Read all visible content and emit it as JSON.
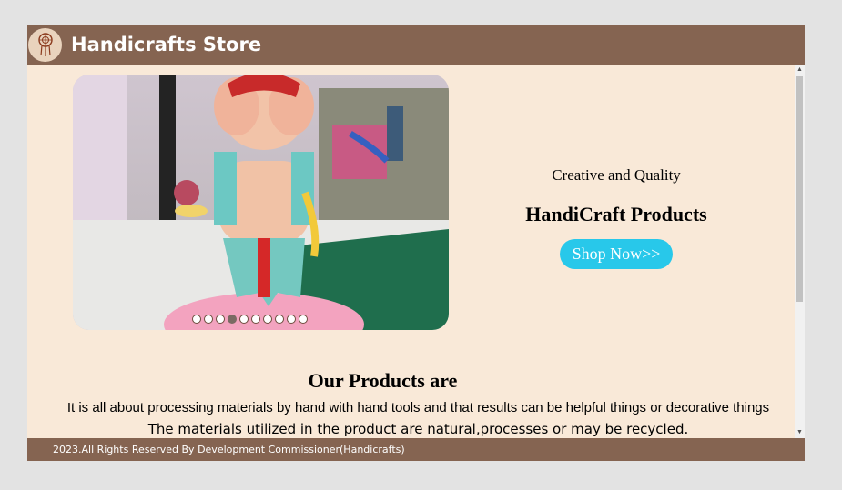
{
  "header": {
    "store_name": "Handicrafts Store",
    "logo_icon": "dreamcatcher-icon"
  },
  "carousel": {
    "slide_count": 10,
    "active_index": 3
  },
  "promo": {
    "tagline": "Creative and Quality",
    "title": "HandiCraft Products",
    "button_label": "Shop Now>>"
  },
  "products": {
    "title": "Our Products are",
    "line1": "It is all about processing materials by hand with hand tools and that results can be helpful things or decorative things",
    "line2": "The materials utilized in the product are natural,processes or may be recycled."
  },
  "footer": {
    "text": "2023.All Rights Reserved By Development Commissioner(Handicrafts)"
  },
  "colors": {
    "header_bg": "#856451",
    "page_bg": "#f9e9d8",
    "button_bg": "#28c8ea"
  }
}
